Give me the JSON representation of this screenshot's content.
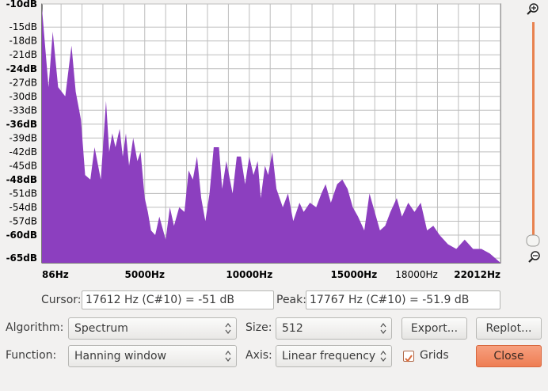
{
  "chart_data": {
    "type": "area",
    "y_ticks": [
      "-10dB",
      "-15dB",
      "-18dB",
      "-21dB",
      "-24dB",
      "-27dB",
      "-30dB",
      "-33dB",
      "-36dB",
      "-39dB",
      "-42dB",
      "-45dB",
      "-48dB",
      "-51dB",
      "-54dB",
      "-57dB",
      "-60dB",
      "-65dB"
    ],
    "y_bold": [
      "-10dB",
      "-24dB",
      "-36dB",
      "-48dB",
      "-60dB",
      "-65dB"
    ],
    "x_ticks": [
      {
        "label": "86Hz",
        "hz": 86
      },
      {
        "label": "5000Hz",
        "hz": 5000
      },
      {
        "label": "10000Hz",
        "hz": 10000
      },
      {
        "label": "15000Hz",
        "hz": 15000
      },
      {
        "label": "18000Hz",
        "hz": 18000
      },
      {
        "label": "22012Hz",
        "hz": 22012
      }
    ],
    "xlim": [
      86,
      22012
    ],
    "ylim": [
      -66,
      -10
    ],
    "fill_color": "#8c3fbf",
    "grid": true,
    "x": [
      86,
      400,
      600,
      860,
      1200,
      1500,
      1700,
      1950,
      2150,
      2400,
      2600,
      2900,
      3150,
      3300,
      3450,
      3600,
      3800,
      3950,
      4100,
      4250,
      4450,
      4650,
      4800,
      5000,
      5150,
      5300,
      5500,
      5700,
      6000,
      6200,
      6400,
      6650,
      6900,
      7100,
      7300,
      7500,
      7700,
      7900,
      8100,
      8300,
      8550,
      8700,
      8900,
      9200,
      9400,
      9600,
      9800,
      10000,
      10200,
      10400,
      10550,
      10750,
      10900,
      11100,
      11300,
      11600,
      11850,
      12100,
      12400,
      12600,
      12900,
      13200,
      13450,
      13650,
      13900,
      14200,
      14450,
      14700,
      14950,
      15200,
      15500,
      15750,
      16000,
      16250,
      16500,
      16750,
      17050,
      17300,
      17600,
      17900,
      18200,
      18500,
      18800,
      19100,
      19500,
      19900,
      20300,
      20700,
      21100,
      21500,
      22012
    ],
    "y": [
      -11,
      -28,
      -16,
      -28,
      -30,
      -19,
      -29,
      -35,
      -47,
      -48,
      -41,
      -48,
      -31,
      -42,
      -38,
      -41,
      -37,
      -43,
      -38,
      -45,
      -39,
      -44,
      -42,
      -52,
      -55,
      -59,
      -60,
      -56,
      -61,
      -54,
      -58,
      -54,
      -55,
      -46,
      -48,
      -43,
      -52,
      -57,
      -51,
      -41,
      -41,
      -50,
      -44,
      -51,
      -43,
      -43,
      -49,
      -43,
      -47,
      -44,
      -52,
      -45,
      -47,
      -42,
      -50,
      -54,
      -51,
      -57,
      -53,
      -55,
      -53,
      -54,
      -51,
      -49,
      -53,
      -49,
      -48,
      -50,
      -54,
      -56,
      -59,
      -51,
      -55,
      -59,
      -58,
      -55,
      -52,
      -56,
      -53,
      -55,
      -53,
      -59,
      -58,
      -60,
      -62,
      -63,
      -61,
      -63,
      -63,
      -64,
      -66
    ]
  },
  "cursor": {
    "label": "Cursor:",
    "value": "17612 Hz (C#10) = -51 dB"
  },
  "peak": {
    "label": "Peak:",
    "value": "17767 Hz (C#10) = -51.9 dB"
  },
  "algorithm": {
    "label": "Algorithm:",
    "value": "Spectrum"
  },
  "size": {
    "label": "Size:",
    "value": "512"
  },
  "function": {
    "label": "Function:",
    "value": "Hanning window"
  },
  "axis": {
    "label": "Axis:",
    "value": "Linear frequency"
  },
  "grids": {
    "label": "Grids",
    "checked": true
  },
  "buttons": {
    "export": "Export...",
    "replot": "Replot...",
    "close": "Close"
  },
  "icons": {
    "zoom_in": "zoom-in-icon",
    "zoom_out": "zoom-out-icon"
  }
}
